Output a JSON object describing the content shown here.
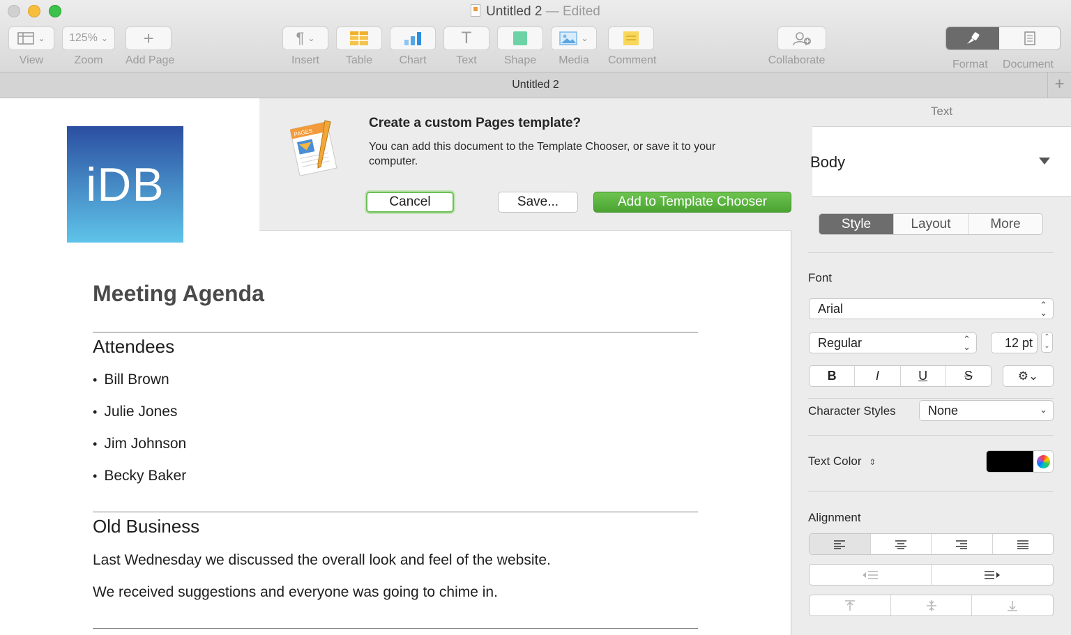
{
  "window": {
    "title": "Untitled 2",
    "edited": "— Edited",
    "tab_title": "Untitled 2",
    "tab_add": "+"
  },
  "toolbar": {
    "view": {
      "label": "View"
    },
    "zoom": {
      "label": "Zoom",
      "value": "125%"
    },
    "add_page": {
      "label": "Add Page",
      "glyph": "+"
    },
    "insert": {
      "label": "Insert",
      "glyph": "¶"
    },
    "table": {
      "label": "Table"
    },
    "chart": {
      "label": "Chart"
    },
    "text": {
      "label": "Text",
      "glyph": "T"
    },
    "shape": {
      "label": "Shape"
    },
    "media": {
      "label": "Media"
    },
    "comment": {
      "label": "Comment"
    },
    "collaborate": {
      "label": "Collaborate"
    },
    "format": {
      "label": "Format"
    },
    "document": {
      "label": "Document"
    }
  },
  "dialog": {
    "icon_text": "PAGES",
    "title": "Create a custom Pages template?",
    "message": "You can add this document to the Template Chooser, or save it to your computer.",
    "cancel": "Cancel",
    "save": "Save...",
    "add": "Add to Template Chooser"
  },
  "document": {
    "logo": "iDB",
    "title": "Meeting Agenda",
    "attendees_heading": "Attendees",
    "attendees": [
      "Bill Brown",
      "Julie Jones",
      "Jim Johnson",
      "Becky Baker"
    ],
    "old_business_heading": "Old Business",
    "paragraphs": [
      "Last Wednesday we discussed the overall look and feel of the website.",
      "We received suggestions and everyone was going to chime in."
    ]
  },
  "inspector": {
    "header": "Text",
    "paragraph_style": "Body",
    "tabs": [
      "Style",
      "Layout",
      "More"
    ],
    "font_label": "Font",
    "font_family": "Arial",
    "font_typeface": "Regular",
    "font_size": "12 pt",
    "format_buttons": [
      "B",
      "I",
      "U",
      "S"
    ],
    "gear": "⚙⌄",
    "char_styles_label": "Character Styles",
    "char_styles_value": "None",
    "text_color_label": "Text Color",
    "text_color_hex": "#000000",
    "alignment_label": "Alignment"
  },
  "colors": {
    "accent_green": "#4aa232",
    "dark_segment": "#6b6b6b"
  }
}
